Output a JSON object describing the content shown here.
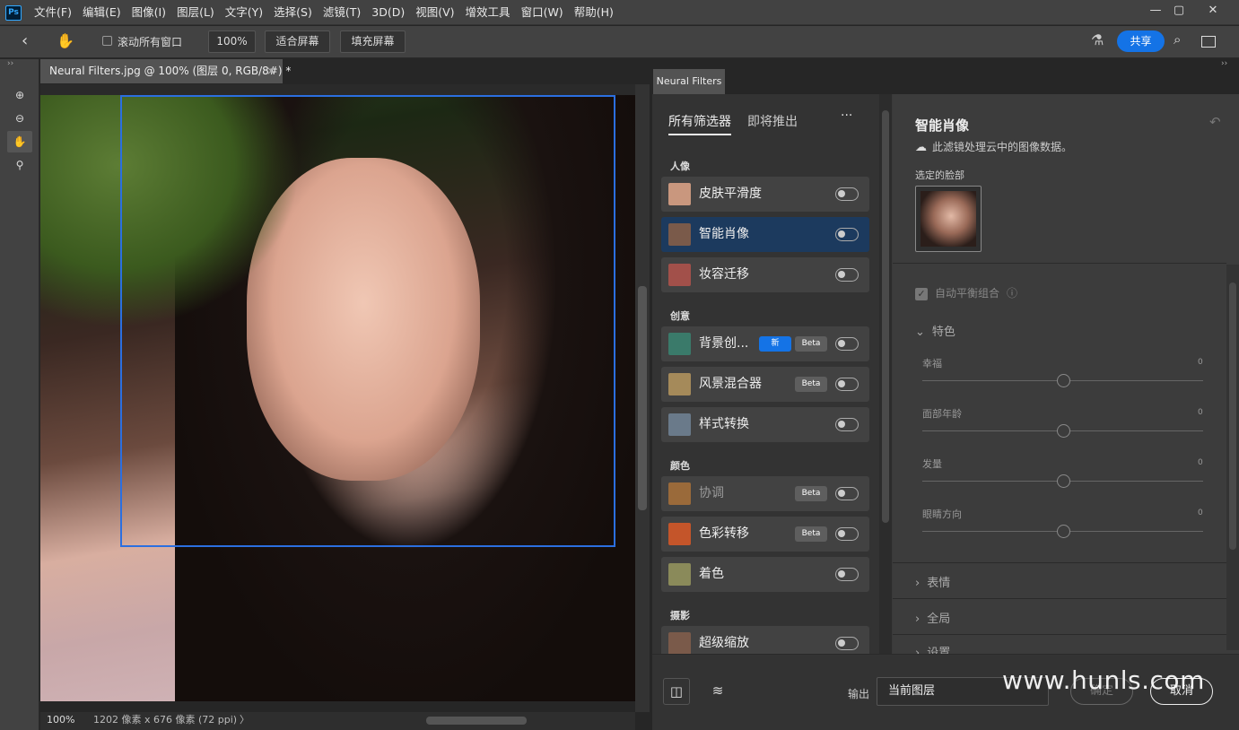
{
  "menubar": {
    "logo": "Ps",
    "items": [
      "文件(F)",
      "编辑(E)",
      "图像(I)",
      "图层(L)",
      "文字(Y)",
      "选择(S)",
      "滤镜(T)",
      "3D(D)",
      "视图(V)",
      "增效工具",
      "窗口(W)",
      "帮助(H)"
    ],
    "window_controls": [
      "—",
      "▢",
      "✕"
    ]
  },
  "options": {
    "scroll_all_label": "滚动所有窗口",
    "zoom_value": "100%",
    "fit_screen": "适合屏幕",
    "fill_screen": "填充屏幕",
    "share": "共享"
  },
  "document": {
    "tab_title": "Neural Filters.jpg @ 100% (图层 0, RGB/8#) *",
    "close": "×",
    "status_zoom": "100%",
    "status_info": "1202 像素 x 676 像素 (72 ppi)",
    "status_arrow": "〉"
  },
  "neural": {
    "tab": "Neural Filters",
    "tabs": [
      "所有筛选器",
      "即将推出"
    ],
    "more": "···",
    "categories": [
      {
        "label": "人像",
        "items": [
          {
            "name": "皮肤平滑度",
            "active": false,
            "dim": false,
            "badges": []
          },
          {
            "name": "智能肖像",
            "active": true,
            "dim": false,
            "badges": []
          },
          {
            "name": "妆容迁移",
            "active": false,
            "dim": false,
            "badges": []
          }
        ]
      },
      {
        "label": "创意",
        "items": [
          {
            "name": "背景创...",
            "active": false,
            "dim": false,
            "badges": [
              "新",
              "Beta"
            ]
          },
          {
            "name": "风景混合器",
            "active": false,
            "dim": false,
            "badges": [
              "Beta"
            ]
          },
          {
            "name": "样式转换",
            "active": false,
            "dim": false,
            "badges": []
          }
        ]
      },
      {
        "label": "颜色",
        "items": [
          {
            "name": "协调",
            "active": false,
            "dim": true,
            "badges": [
              "Beta"
            ]
          },
          {
            "name": "色彩转移",
            "active": false,
            "dim": false,
            "badges": [
              "Beta"
            ]
          },
          {
            "name": "着色",
            "active": false,
            "dim": false,
            "badges": []
          }
        ]
      },
      {
        "label": "摄影",
        "items": [
          {
            "name": "超级缩放",
            "active": false,
            "dim": false,
            "badges": []
          }
        ]
      }
    ],
    "detail": {
      "title": "智能肖像",
      "cloud_note": "此滤镜处理云中的图像数据。",
      "face_label": "选定的脸部",
      "auto_balance": "自动平衡组合",
      "section_featured": "特色",
      "sliders": [
        {
          "label": "幸福",
          "value": "0",
          "level": 0
        },
        {
          "label": "面部年龄",
          "value": "0",
          "level": 0
        },
        {
          "label": "发量",
          "value": "0",
          "level": 0
        },
        {
          "label": "眼睛方向",
          "value": "0",
          "level": 0
        }
      ],
      "section_expression": "表情",
      "section_global": "全局",
      "section_settings": "设置"
    },
    "output_label": "输出",
    "output_value": "当前图层",
    "ok": "确定",
    "cancel": "取消"
  },
  "watermark": "www.hunls.com",
  "colors": {
    "accent": "#1473e6",
    "selection": "#2b6fe0",
    "active_item": "#1c3a5e"
  }
}
